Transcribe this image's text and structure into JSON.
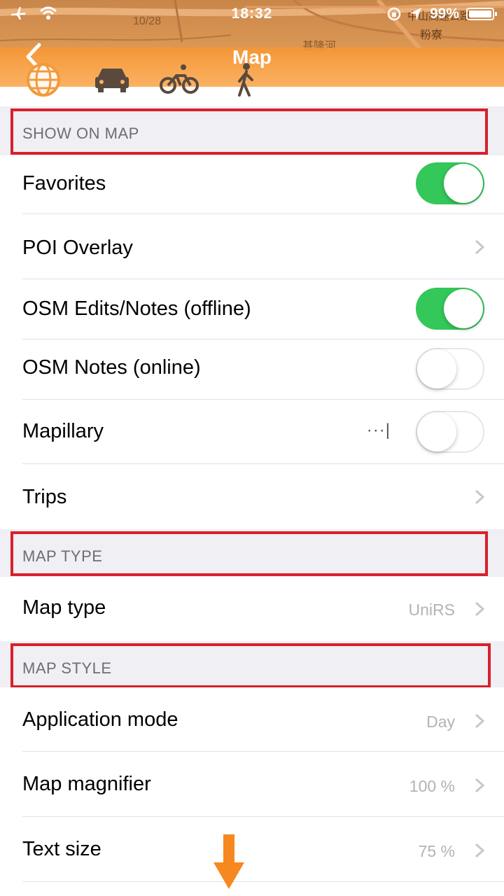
{
  "status": {
    "time": "18:32",
    "battery": "99%"
  },
  "map_labels": {
    "road_number": "10/28",
    "district": "基隆河",
    "place1": "粉寮",
    "place2": "中山高速公路"
  },
  "header": {
    "title": "Map",
    "back_icon": "chevron-left-icon",
    "modes": [
      "globe-icon",
      "car-icon",
      "bicycle-icon",
      "pedestrian-icon"
    ]
  },
  "sections": {
    "show_on_map": "SHOW ON MAP",
    "map_type": "MAP TYPE",
    "map_style": "MAP STYLE"
  },
  "rows": {
    "favorites": "Favorites",
    "poi_overlay": "POI Overlay",
    "osm_edits": "OSM Edits/Notes (offline)",
    "osm_notes": "OSM Notes (online)",
    "mapillary": "Mapillary",
    "mapillary_extra": "···|",
    "trips": "Trips",
    "map_type": "Map type",
    "map_type_value": "UniRS",
    "app_mode": "Application mode",
    "app_mode_value": "Day",
    "magnifier": "Map magnifier",
    "magnifier_value": "100 %",
    "text_size": "Text size",
    "text_size_value": "75 %"
  },
  "toggles": {
    "favorites": true,
    "osm_edits": true,
    "osm_notes": false,
    "mapillary": false
  },
  "colors": {
    "accent_orange": "#f39a3c",
    "toggle_on": "#34c759",
    "highlight_box": "#d9202a",
    "scroll_arrow": "#f7871f"
  }
}
